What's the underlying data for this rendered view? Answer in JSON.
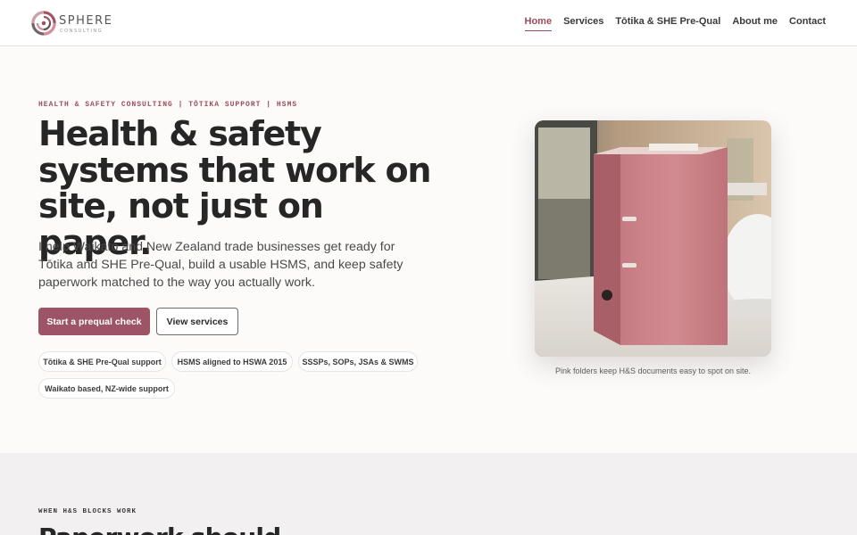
{
  "brand": {
    "name": "SPHERE",
    "tagline": "CONSULTING",
    "logo_icon": "swirl-logo-icon",
    "accent_color": "#9d5466"
  },
  "nav": {
    "items": [
      {
        "label": "Home",
        "active": true
      },
      {
        "label": "Services"
      },
      {
        "label": "Tōtika & SHE Pre-Qual"
      },
      {
        "label": "About me"
      },
      {
        "label": "Contact"
      }
    ]
  },
  "hero": {
    "eyebrow": "HEALTH & SAFETY CONSULTING | TŌTIKA SUPPORT | HSMS",
    "headline_lines": [
      "Health & safety",
      "systems that work on",
      "site, not just on paper."
    ],
    "lead": "I help Waikato and New Zealand trade businesses get ready for Tōtika and SHE Pre-Qual, build a usable HSMS, and keep safety paperwork matched to the way you actually work.",
    "primary_cta": "Start a prequal check",
    "secondary_cta": "View services",
    "chips": [
      "Tōtika & SHE Pre-Qual support",
      "HSMS aligned to HSWA 2015",
      "SSSPs, SOPs, JSAs & SWMS",
      "Waikato based, NZ-wide support"
    ],
    "image_caption": "Pink folders keep H&S documents easy to spot on site."
  },
  "section2": {
    "eyebrow": "WHEN H&S BLOCKS WORK",
    "headline": "Paperwork should"
  }
}
